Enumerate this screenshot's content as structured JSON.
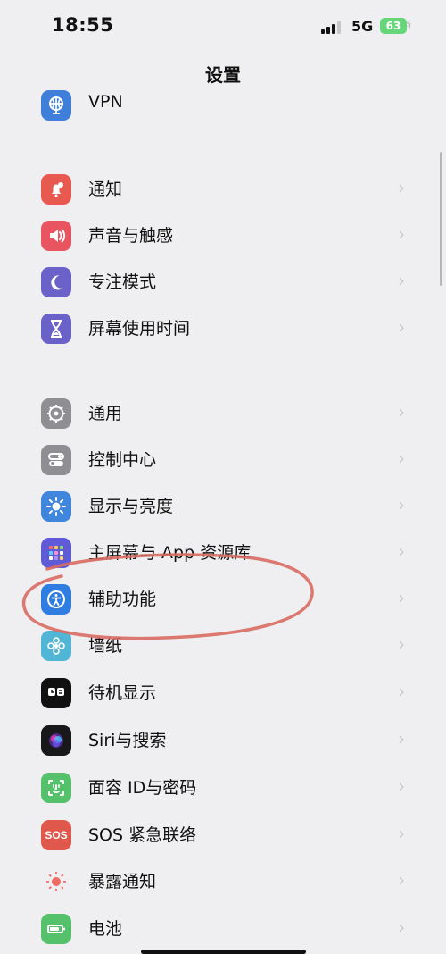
{
  "status_bar": {
    "time": "18:55",
    "network": "5G",
    "battery": "63"
  },
  "header": {
    "title": "设置"
  },
  "settings": {
    "items": [
      {
        "label": "VPN",
        "icon": "vpn-icon",
        "color": "#3f7ed9"
      },
      {
        "label": "通知",
        "icon": "bell-icon",
        "color": "#e85a4f"
      },
      {
        "label": "声音与触感",
        "icon": "speaker-icon",
        "color": "#e85460"
      },
      {
        "label": "专注模式",
        "icon": "moon-icon",
        "color": "#6b62c9"
      },
      {
        "label": "屏幕使用时间",
        "icon": "hourglass-icon",
        "color": "#6b62c9"
      },
      {
        "label": "通用",
        "icon": "gear-icon",
        "color": "#8e8e93"
      },
      {
        "label": "控制中心",
        "icon": "toggles-icon",
        "color": "#8e8e93"
      },
      {
        "label": "显示与亮度",
        "icon": "sun-icon",
        "color": "#3f86dc"
      },
      {
        "label": "主屏幕与 App 资源库",
        "icon": "app-grid-icon",
        "color": "#5f5bd6"
      },
      {
        "label": "辅助功能",
        "icon": "accessibility-icon",
        "color": "#2f7de1"
      },
      {
        "label": "墙纸",
        "icon": "flower-icon",
        "color": "#51b6d6"
      },
      {
        "label": "待机显示",
        "icon": "standby-icon",
        "color": "#111111"
      },
      {
        "label": "Siri与搜索",
        "icon": "siri-icon",
        "color": "#18181a"
      },
      {
        "label": "面容 ID与密码",
        "icon": "face-id-icon",
        "color": "#55c26b"
      },
      {
        "label": "SOS 紧急联络",
        "icon": "sos-icon",
        "color": "#e0584c"
      },
      {
        "label": "暴露通知",
        "icon": "exposure-icon",
        "color": "#ffffff"
      },
      {
        "label": "电池",
        "icon": "battery-setting-icon",
        "color": "#55c26b"
      }
    ],
    "sos_icon_text": "SOS"
  }
}
